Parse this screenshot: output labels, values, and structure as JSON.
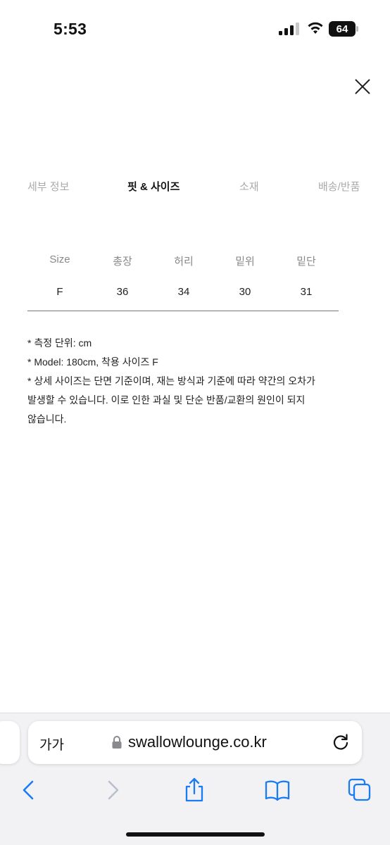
{
  "status_bar": {
    "time": "5:53",
    "battery": "64",
    "icons": [
      "cellular-signal-icon",
      "wifi-icon",
      "battery-icon"
    ]
  },
  "close_icon": "close-icon",
  "tabs": [
    {
      "label": "세부 정보",
      "active": false
    },
    {
      "label": "핏 & 사이즈",
      "active": true
    },
    {
      "label": "소재",
      "active": false
    },
    {
      "label": "배송/반품",
      "active": false
    }
  ],
  "size_table": {
    "headers": [
      "Size",
      "총장",
      "허리",
      "밑위",
      "밑단"
    ],
    "rows": [
      [
        "F",
        "36",
        "34",
        "30",
        "31"
      ]
    ]
  },
  "notes": [
    "* 측정 단위: cm",
    "* Model: 180cm, 착용 사이즈 F",
    "* 상세 사이즈는 단면 기준이며, 재는 방식과 기준에 따라 약간의 오차가",
    "발생할 수 있습니다. 이로 인한 과실 및 단순 반품/교환의 원인이 되지",
    "않습니다."
  ],
  "browser": {
    "text_size_label": "가가",
    "url": "swallowlounge.co.kr",
    "toolbar_icons": [
      "back-icon",
      "forward-icon",
      "share-icon",
      "bookmarks-icon",
      "tabs-icon"
    ]
  },
  "colors": {
    "accent_ios_blue": "#1a7cf5",
    "inactive_tab": "#aaaaaa",
    "text": "#222222"
  }
}
